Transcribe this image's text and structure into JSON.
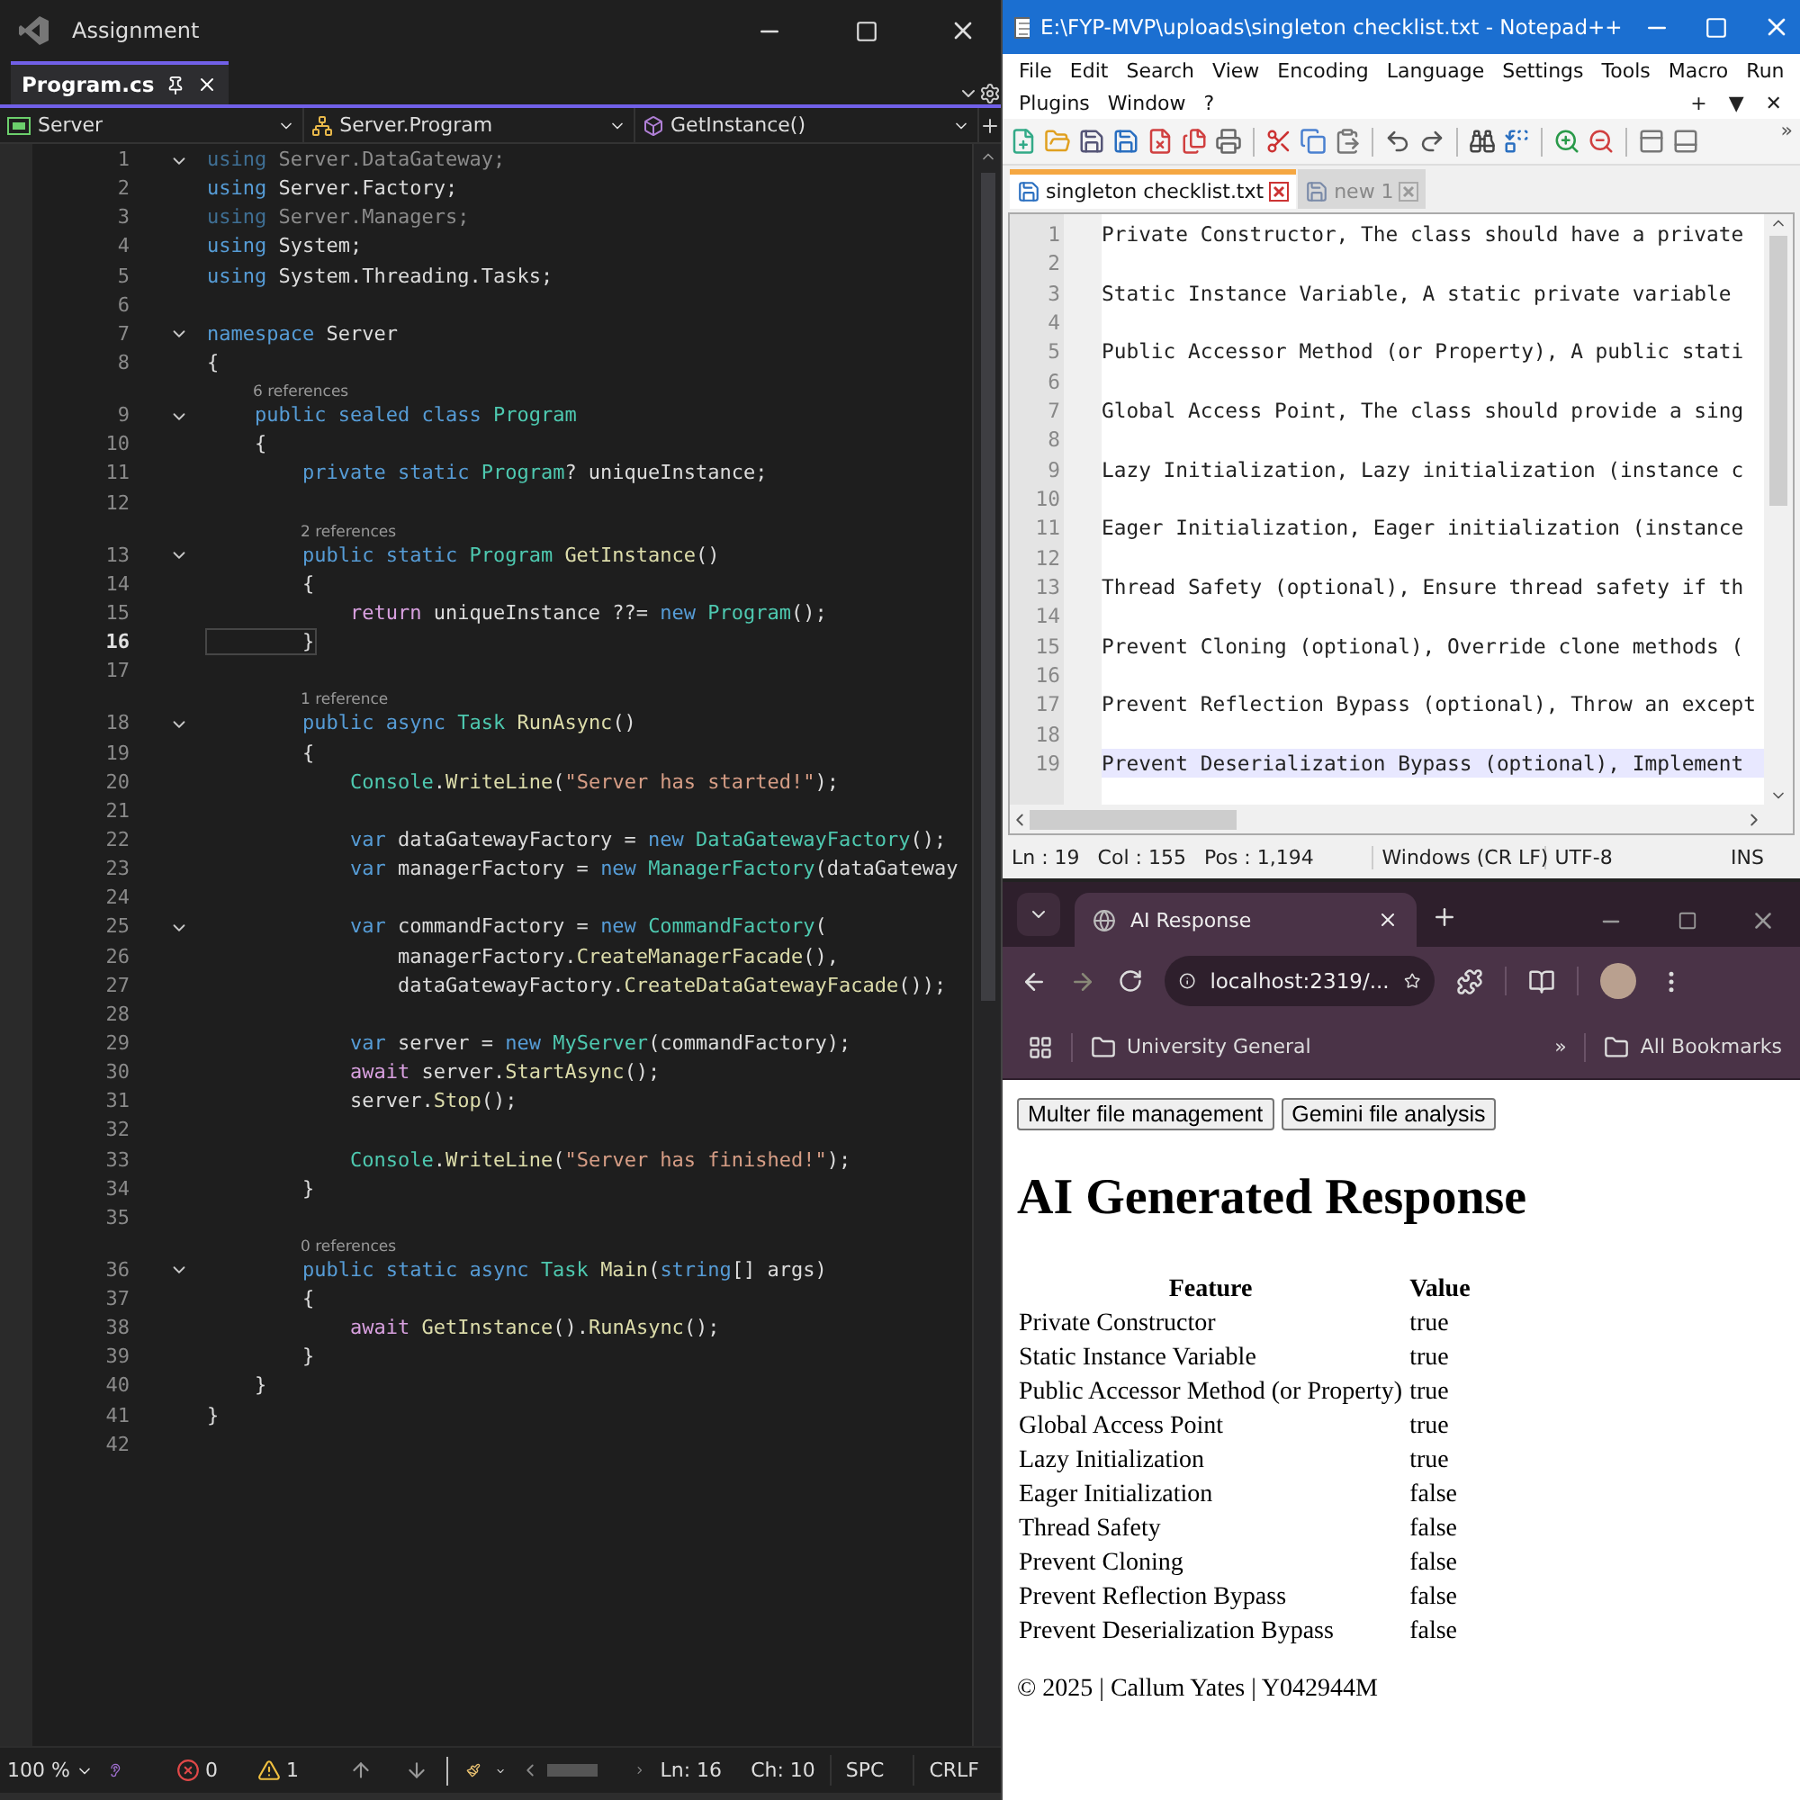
{
  "ide": {
    "title": "Assignment",
    "tab": {
      "label": "Program.cs",
      "selected": true
    },
    "nav": [
      "Server",
      "Server.Program",
      "GetInstance()"
    ],
    "lines": [
      {
        "num": "1",
        "fold": true,
        "current": false,
        "tokens": [
          {
            "text": "using",
            "kind": "kwdim"
          },
          {
            "text": " Server.DataGateway;",
            "kind": "dim"
          }
        ]
      },
      {
        "num": "2",
        "fold": false,
        "current": false,
        "tokens": [
          {
            "text": "using",
            "kind": "kw"
          },
          {
            "text": " Server.Factory;",
            "kind": "plain"
          }
        ]
      },
      {
        "num": "3",
        "fold": false,
        "current": false,
        "tokens": [
          {
            "text": "using",
            "kind": "kwdim"
          },
          {
            "text": " Server.Managers;",
            "kind": "dim"
          }
        ]
      },
      {
        "num": "4",
        "fold": false,
        "current": false,
        "tokens": [
          {
            "text": "using",
            "kind": "kw"
          },
          {
            "text": " System;",
            "kind": "plain"
          }
        ]
      },
      {
        "num": "5",
        "fold": false,
        "current": false,
        "tokens": [
          {
            "text": "using",
            "kind": "kw"
          },
          {
            "text": " System.Threading.Tasks;",
            "kind": "plain"
          }
        ]
      },
      {
        "num": "6",
        "fold": false,
        "current": false
      },
      {
        "num": "7",
        "fold": true,
        "current": false,
        "tokens": [
          {
            "text": "namespace",
            "kind": "kw"
          },
          {
            "text": " Server",
            "kind": "plain"
          }
        ]
      },
      {
        "num": "8",
        "fold": false,
        "current": false,
        "tokens": [
          {
            "text": "{",
            "kind": "plain"
          }
        ]
      },
      {
        "num": "9",
        "fold": true,
        "current": false,
        "lens": "6 references",
        "tokens": [
          {
            "text": "    public sealed class ",
            "kind": "kw"
          },
          {
            "text": "Program",
            "kind": "type"
          }
        ]
      },
      {
        "num": "10",
        "fold": false,
        "current": false,
        "tokens": [
          {
            "text": "    {",
            "kind": "plain"
          }
        ]
      },
      {
        "num": "11",
        "fold": false,
        "current": false,
        "tokens": [
          {
            "text": "        private static ",
            "kind": "kw"
          },
          {
            "text": "Program",
            "kind": "type"
          },
          {
            "text": "? uniqueInstance;",
            "kind": "plain"
          }
        ]
      },
      {
        "num": "12",
        "fold": false,
        "current": false
      },
      {
        "num": "13",
        "fold": true,
        "current": false,
        "lens": "2 references",
        "tokens": [
          {
            "text": "        public static ",
            "kind": "kw"
          },
          {
            "text": "Program ",
            "kind": "type"
          },
          {
            "text": "GetInstance",
            "kind": "method"
          },
          {
            "text": "()",
            "kind": "plain"
          }
        ]
      },
      {
        "num": "14",
        "fold": false,
        "current": false,
        "tokens": [
          {
            "text": "        {",
            "kind": "plain"
          }
        ]
      },
      {
        "num": "15",
        "fold": false,
        "current": false,
        "tokens": [
          {
            "text": "            return",
            "kind": "ctrl"
          },
          {
            "text": " uniqueInstance ??= ",
            "kind": "plain"
          },
          {
            "text": "new ",
            "kind": "kw"
          },
          {
            "text": "Program",
            "kind": "type"
          },
          {
            "text": "();",
            "kind": "plain"
          }
        ]
      },
      {
        "num": "16",
        "fold": false,
        "current": true,
        "tokens": [
          {
            "text": "        }",
            "kind": "plain"
          }
        ]
      },
      {
        "num": "17",
        "fold": false,
        "current": false
      },
      {
        "num": "18",
        "fold": true,
        "current": false,
        "lens": "1 reference",
        "tokens": [
          {
            "text": "        public async ",
            "kind": "kw"
          },
          {
            "text": "Task ",
            "kind": "type"
          },
          {
            "text": "RunAsync",
            "kind": "method"
          },
          {
            "text": "()",
            "kind": "plain"
          }
        ]
      },
      {
        "num": "19",
        "fold": false,
        "current": false,
        "tokens": [
          {
            "text": "        {",
            "kind": "plain"
          }
        ]
      },
      {
        "num": "20",
        "fold": false,
        "current": false,
        "tokens": [
          {
            "text": "            Console",
            "kind": "type"
          },
          {
            "text": ".",
            "kind": "plain"
          },
          {
            "text": "WriteLine",
            "kind": "method"
          },
          {
            "text": "(",
            "kind": "plain"
          },
          {
            "text": "\"Server has started!\"",
            "kind": "str"
          },
          {
            "text": ");",
            "kind": "plain"
          }
        ]
      },
      {
        "num": "21",
        "fold": false,
        "current": false
      },
      {
        "num": "22",
        "fold": false,
        "current": false,
        "tokens": [
          {
            "text": "            var",
            "kind": "kw"
          },
          {
            "text": " dataGatewayFactory = ",
            "kind": "plain"
          },
          {
            "text": "new ",
            "kind": "kw"
          },
          {
            "text": "DataGatewayFactory",
            "kind": "type"
          },
          {
            "text": "();",
            "kind": "plain"
          }
        ]
      },
      {
        "num": "23",
        "fold": false,
        "current": false,
        "tokens": [
          {
            "text": "            var",
            "kind": "kw"
          },
          {
            "text": " managerFactory = ",
            "kind": "plain"
          },
          {
            "text": "new ",
            "kind": "kw"
          },
          {
            "text": "ManagerFactory",
            "kind": "type"
          },
          {
            "text": "(dataGateway",
            "kind": "plain"
          }
        ]
      },
      {
        "num": "24",
        "fold": false,
        "current": false
      },
      {
        "num": "25",
        "fold": true,
        "current": false,
        "tokens": [
          {
            "text": "            var",
            "kind": "kw"
          },
          {
            "text": " commandFactory = ",
            "kind": "plain"
          },
          {
            "text": "new ",
            "kind": "kw"
          },
          {
            "text": "CommandFactory",
            "kind": "type"
          },
          {
            "text": "(",
            "kind": "plain"
          }
        ]
      },
      {
        "num": "26",
        "fold": false,
        "current": false,
        "tokens": [
          {
            "text": "                managerFactory.",
            "kind": "plain"
          },
          {
            "text": "CreateManagerFacade",
            "kind": "method"
          },
          {
            "text": "(),",
            "kind": "plain"
          }
        ]
      },
      {
        "num": "27",
        "fold": false,
        "current": false,
        "tokens": [
          {
            "text": "                dataGatewayFactory.",
            "kind": "plain"
          },
          {
            "text": "CreateDataGatewayFacade",
            "kind": "method"
          },
          {
            "text": "());",
            "kind": "plain"
          }
        ]
      },
      {
        "num": "28",
        "fold": false,
        "current": false
      },
      {
        "num": "29",
        "fold": false,
        "current": false,
        "tokens": [
          {
            "text": "            var",
            "kind": "kw"
          },
          {
            "text": " server = ",
            "kind": "plain"
          },
          {
            "text": "new ",
            "kind": "kw"
          },
          {
            "text": "MyServer",
            "kind": "type"
          },
          {
            "text": "(commandFactory);",
            "kind": "plain"
          }
        ]
      },
      {
        "num": "30",
        "fold": false,
        "current": false,
        "tokens": [
          {
            "text": "            await",
            "kind": "ctrl"
          },
          {
            "text": " server.",
            "kind": "plain"
          },
          {
            "text": "StartAsync",
            "kind": "method"
          },
          {
            "text": "();",
            "kind": "plain"
          }
        ]
      },
      {
        "num": "31",
        "fold": false,
        "current": false,
        "tokens": [
          {
            "text": "            server.",
            "kind": "plain"
          },
          {
            "text": "Stop",
            "kind": "method"
          },
          {
            "text": "();",
            "kind": "plain"
          }
        ]
      },
      {
        "num": "32",
        "fold": false,
        "current": false
      },
      {
        "num": "33",
        "fold": false,
        "current": false,
        "tokens": [
          {
            "text": "            Console",
            "kind": "type"
          },
          {
            "text": ".",
            "kind": "plain"
          },
          {
            "text": "WriteLine",
            "kind": "method"
          },
          {
            "text": "(",
            "kind": "plain"
          },
          {
            "text": "\"Server has finished!\"",
            "kind": "str"
          },
          {
            "text": ");",
            "kind": "plain"
          }
        ]
      },
      {
        "num": "34",
        "fold": false,
        "current": false,
        "tokens": [
          {
            "text": "        }",
            "kind": "plain"
          }
        ]
      },
      {
        "num": "35",
        "fold": false,
        "current": false
      },
      {
        "num": "36",
        "fold": true,
        "current": false,
        "lens": "0 references",
        "tokens": [
          {
            "text": "        public static async ",
            "kind": "kw"
          },
          {
            "text": "Task ",
            "kind": "type"
          },
          {
            "text": "Main",
            "kind": "method"
          },
          {
            "text": "(",
            "kind": "plain"
          },
          {
            "text": "string",
            "kind": "kw"
          },
          {
            "text": "[] args)",
            "kind": "plain"
          }
        ]
      },
      {
        "num": "37",
        "fold": false,
        "current": false,
        "tokens": [
          {
            "text": "        {",
            "kind": "plain"
          }
        ]
      },
      {
        "num": "38",
        "fold": false,
        "current": false,
        "tokens": [
          {
            "text": "            await ",
            "kind": "ctrl"
          },
          {
            "text": "GetInstance",
            "kind": "method"
          },
          {
            "text": "().",
            "kind": "plain"
          },
          {
            "text": "RunAsync",
            "kind": "method"
          },
          {
            "text": "();",
            "kind": "plain"
          }
        ]
      },
      {
        "num": "39",
        "fold": false,
        "current": false,
        "tokens": [
          {
            "text": "        }",
            "kind": "plain"
          }
        ]
      },
      {
        "num": "40",
        "fold": false,
        "current": false,
        "tokens": [
          {
            "text": "    }",
            "kind": "plain"
          }
        ]
      },
      {
        "num": "41",
        "fold": false,
        "current": false,
        "tokens": [
          {
            "text": "}",
            "kind": "plain"
          }
        ]
      },
      {
        "num": "42",
        "fold": false,
        "current": false
      }
    ],
    "status": {
      "zoom": "100 %",
      "errors": "0",
      "warnings": "1",
      "line": "Ln: 16",
      "col": "Ch: 10",
      "indent": "SPC",
      "eol": "CRLF"
    }
  },
  "notepad": {
    "title": "E:\\FYP-MVP\\uploads\\singleton checklist.txt - Notepad++",
    "menu": [
      "File",
      "Edit",
      "Search",
      "View",
      "Encoding",
      "Language",
      "Settings",
      "Tools",
      "Macro",
      "Run"
    ],
    "menu2": [
      "Plugins",
      "Window",
      "?"
    ],
    "menu_controls": [
      "+",
      "▼",
      "✕"
    ],
    "toolbar_more": "»",
    "tabs": [
      {
        "label": "singleton checklist.txt",
        "selected": true
      },
      {
        "label": "new 1",
        "selected": false
      }
    ],
    "lines": [
      {
        "num": "1",
        "text": "Private Constructor, The class should have a private",
        "current": false
      },
      {
        "num": "2",
        "current": false
      },
      {
        "num": "3",
        "text": "Static Instance Variable, A static private variable",
        "current": false
      },
      {
        "num": "4",
        "current": false
      },
      {
        "num": "5",
        "text": "Public Accessor Method (or Property), A public stati",
        "current": false
      },
      {
        "num": "6",
        "current": false
      },
      {
        "num": "7",
        "text": "Global Access Point, The class should provide a sing",
        "current": false
      },
      {
        "num": "8",
        "current": false
      },
      {
        "num": "9",
        "text": "Lazy Initialization, Lazy initialization (instance c",
        "current": false
      },
      {
        "num": "10",
        "current": false
      },
      {
        "num": "11",
        "text": "Eager Initialization, Eager initialization (instance",
        "current": false
      },
      {
        "num": "12",
        "current": false
      },
      {
        "num": "13",
        "text": "Thread Safety (optional), Ensure thread safety if th",
        "current": false
      },
      {
        "num": "14",
        "current": false
      },
      {
        "num": "15",
        "text": "Prevent Cloning (optional), Override clone methods (",
        "current": false
      },
      {
        "num": "16",
        "current": false
      },
      {
        "num": "17",
        "text": "Prevent Reflection Bypass (optional), Throw an except",
        "current": false
      },
      {
        "num": "18",
        "current": false
      },
      {
        "num": "19",
        "text": "Prevent Deserialization Bypass (optional), Implement",
        "current": true
      }
    ],
    "status": [
      "Ln : 19",
      "Col : 155",
      "Pos : 1,194",
      "Windows (CR LF)",
      "UTF-8",
      "INS"
    ]
  },
  "browser": {
    "tab": "AI Response",
    "url": "localhost:2319/...",
    "bookmarks": [
      "University General"
    ],
    "bookmarks_more": "»",
    "all_bookmarks": "All Bookmarks",
    "buttons": [
      "Multer file management",
      "Gemini file analysis"
    ],
    "heading": "AI Generated Response",
    "table": {
      "columns": [
        "Feature",
        "Value"
      ],
      "rows": [
        [
          "Private Constructor",
          "true"
        ],
        [
          "Static Instance Variable",
          "true"
        ],
        [
          "Public Accessor Method (or Property)",
          "true"
        ],
        [
          "Global Access Point",
          "true"
        ],
        [
          "Lazy Initialization",
          "true"
        ],
        [
          "Eager Initialization",
          "false"
        ],
        [
          "Thread Safety",
          "false"
        ],
        [
          "Prevent Cloning",
          "false"
        ],
        [
          "Prevent Reflection Bypass",
          "false"
        ],
        [
          "Prevent Deserialization Bypass",
          "false"
        ]
      ]
    },
    "footer": "© 2025 | Callum Yates | Y042944M"
  }
}
